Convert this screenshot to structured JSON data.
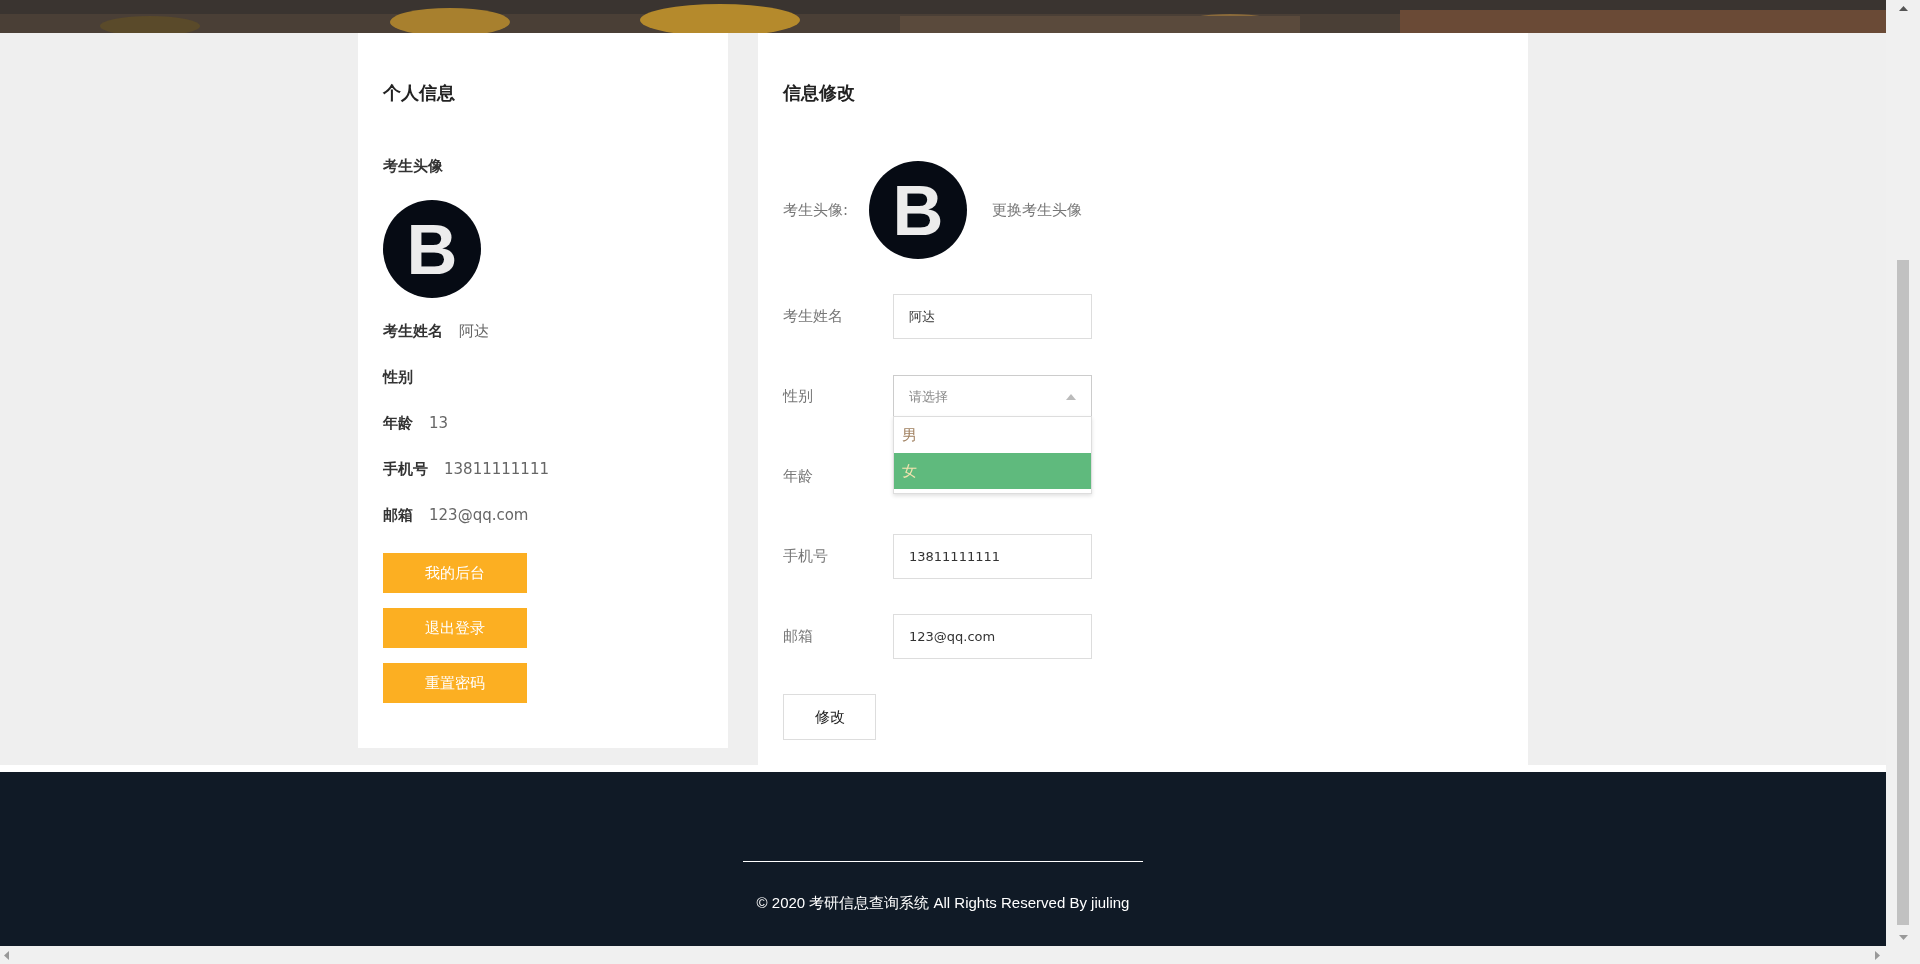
{
  "profile": {
    "title": "个人信息",
    "avatar_label": "考生头像",
    "avatar_letter": "B",
    "fields": [
      {
        "label": "考生姓名",
        "value": "阿达"
      },
      {
        "label": "性别"
      },
      {
        "label": "年龄",
        "value": "13"
      },
      {
        "label": "手机号",
        "value": "13811111111"
      },
      {
        "label": "邮箱",
        "value": "123@qq.com"
      }
    ],
    "buttons": [
      "我的后台",
      "退出登录",
      "重置密码"
    ]
  },
  "edit": {
    "title": "信息修改",
    "avatar_label": "考生头像:",
    "avatar_letter": "B",
    "change_avatar": "更换考生头像",
    "fields": [
      {
        "kind": "input",
        "label": "考生姓名",
        "value": "阿达"
      },
      {
        "kind": "select",
        "label": "性别",
        "placeholder": "请选择",
        "expanded": true,
        "options": [
          {
            "label": "男",
            "selected": false
          },
          {
            "label": "女",
            "selected": true
          }
        ]
      },
      {
        "kind": "hidden",
        "label": "年龄"
      },
      {
        "kind": "input",
        "label": "手机号",
        "value": "13811111111"
      },
      {
        "kind": "input",
        "label": "邮箱",
        "value": "123@qq.com"
      }
    ],
    "submit": "修改"
  },
  "footer": {
    "copyright": "© 2020 考研信息查询系统 All Rights Reserved By jiuling"
  }
}
